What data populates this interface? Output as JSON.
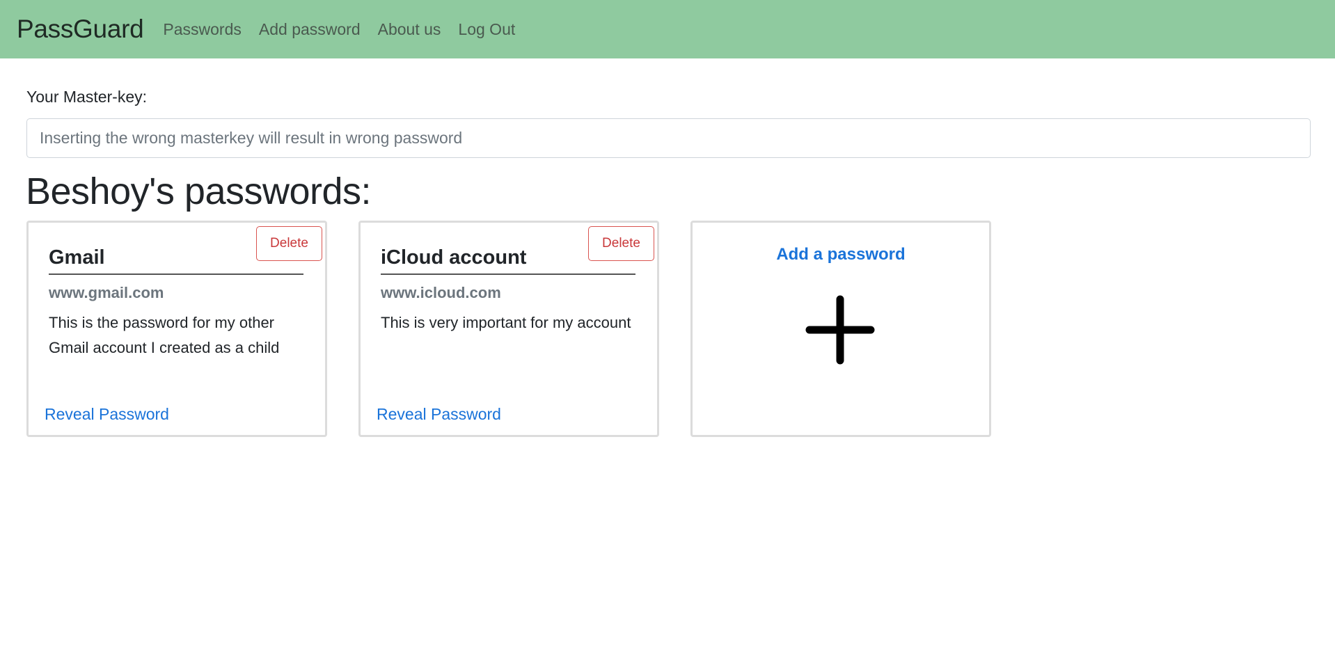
{
  "navbar": {
    "brand": "PassGuard",
    "links": [
      "Passwords",
      "Add password",
      "About us",
      "Log Out"
    ]
  },
  "masterkey": {
    "label": "Your Master-key:",
    "placeholder": "Inserting the wrong masterkey will result in wrong password",
    "value": ""
  },
  "section_title": "Beshoy's passwords:",
  "cards": [
    {
      "title": "Gmail",
      "url": "www.gmail.com",
      "description": "This is the password for my other Gmail account I created as a child",
      "delete_label": "Delete",
      "reveal_label": "Reveal Password"
    },
    {
      "title": "iCloud account",
      "url": "www.icloud.com",
      "description": "This is very important for my account",
      "delete_label": "Delete",
      "reveal_label": "Reveal Password"
    }
  ],
  "add_card": {
    "label": "Add a password",
    "icon": "plus-icon"
  },
  "colors": {
    "navbar_bg": "#8fca9f",
    "link": "#1a73d9",
    "danger": "#c9383a"
  }
}
